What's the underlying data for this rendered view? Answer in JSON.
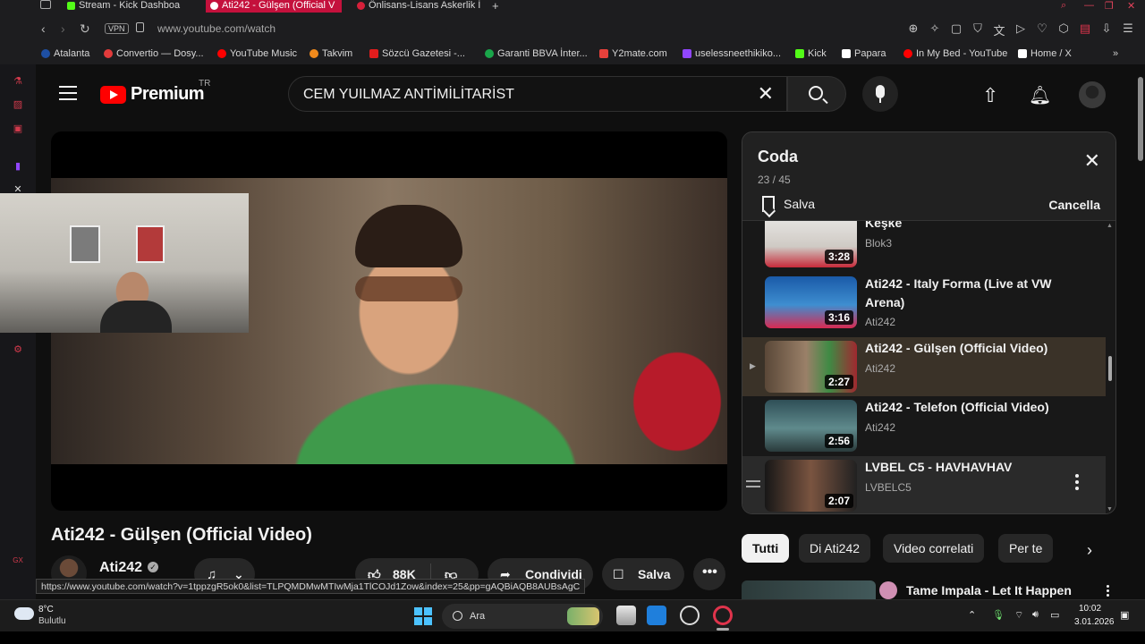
{
  "browser": {
    "tabs": [
      {
        "label": "Stream - Kick Dashboa",
        "color": "#53fc18"
      },
      {
        "label": "Ati242 - Gülşen (Official V",
        "color": "#ff0000"
      },
      {
        "label": "Önlisans-Lisans Askerlik İ",
        "color": "#d6203a"
      }
    ],
    "vpn_label": "VPN",
    "url": "www.youtube.com/watch",
    "bookmarks": [
      {
        "label": "Atalanta",
        "color": "#1e4fa3"
      },
      {
        "label": "Convertio — Dosy...",
        "color": "#e23b3b"
      },
      {
        "label": "YouTube Music",
        "color": "#ff0000"
      },
      {
        "label": "Takvim",
        "color": "#f08a1c"
      },
      {
        "label": "Sözcü Gazetesi -...",
        "color": "#e11d1d"
      },
      {
        "label": "Garanti BBVA İnter...",
        "color": "#1aa64a"
      },
      {
        "label": "Y2mate.com",
        "color": "#e8413b"
      },
      {
        "label": "uselessneethikiko...",
        "color": "#9146ff"
      },
      {
        "label": "Kick",
        "color": "#53fc18"
      },
      {
        "label": "Papara",
        "color": "#ffffff"
      },
      {
        "label": "In My Bed - YouTube",
        "color": "#ff0000"
      },
      {
        "label": "Home / X",
        "color": "#ffffff"
      }
    ]
  },
  "youtube": {
    "logo_text": "Premium",
    "country_code": "TR",
    "search_query": "CEM YUILMAZ ANTİMİLİTARİST",
    "video_title": "Ati242 - Gülşen (Official Video)",
    "channel_name": "Ati242",
    "like_count": "88K",
    "share_label": "Condividi",
    "save_label": "Salva"
  },
  "queue": {
    "title": "Coda",
    "position": "23 / 45",
    "save_label": "Salva",
    "cancel_label": "Cancella",
    "items": [
      {
        "title": "Keşke",
        "channel": "Blok3",
        "duration": "3:28",
        "thumb": "linear-gradient(180deg,#e8e6e4 0%,#cfcac4 60%,#c72a3a 100%)"
      },
      {
        "title": "Ati242 - Italy Forma (Live at VW Arena)",
        "channel": "Ati242",
        "duration": "3:16",
        "thumb": "linear-gradient(180deg,#1a5aa8 0%,#3e8ed0 55%,#d82a52 100%)"
      },
      {
        "title": "Ati242 - Gülşen (Official Video)",
        "channel": "Ati242",
        "duration": "2:27",
        "thumb": "linear-gradient(90deg,#5a4838 0%,#9a8068 45%,#3f8a44 70%,#a0282f 100%)"
      },
      {
        "title": "Ati242 - Telefon (Official Video)",
        "channel": "Ati242",
        "duration": "2:56",
        "thumb": "linear-gradient(180deg,#2f4f57 0%,#5f8a8c 55%,#2a3a3b 100%)"
      },
      {
        "title": "LVBEL C5 - HAVHAVHAV",
        "channel": "LVBELC5",
        "duration": "2:07",
        "thumb": "linear-gradient(90deg,#171717 0%,#7a5440 50%,#212121 100%)"
      }
    ]
  },
  "chips": [
    "Tutti",
    "Di Ati242",
    "Video correlati",
    "Per te"
  ],
  "recommended": {
    "title": "Tame Impala - Let It Happen"
  },
  "status_url": "https://www.youtube.com/watch?v=1tppzgR5ok0&list=TLPQMDMwMTIwMja1TlCOJd1Zow&index=25&pp=gAQBiAQB8AUBsAgC",
  "taskbar": {
    "temperature": "8°C",
    "weather": "Bulutlu",
    "search_label": "Ara",
    "time": "10:02",
    "date": "3.01.2026"
  }
}
